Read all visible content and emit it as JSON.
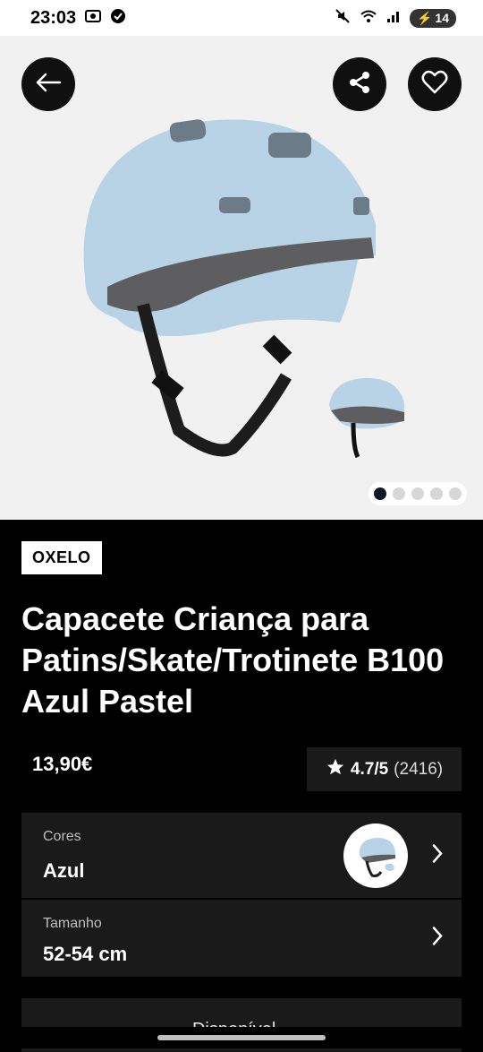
{
  "status_bar": {
    "time": "23:03",
    "battery": "14",
    "icons": [
      "screenshot-icon",
      "check-circle-icon",
      "mute-icon",
      "wifi-icon",
      "signal-icon",
      "battery-icon"
    ]
  },
  "hero": {
    "icons": [
      "back-arrow-icon",
      "share-icon",
      "heart-icon"
    ],
    "image_alt": "helmet",
    "dots_total": 5,
    "active_dot": 1
  },
  "product": {
    "brand": "OXELO",
    "title": "Capacete Criança para Patins/Skate/Trotinete B100 Azul Pastel",
    "price": "13,90€",
    "rating_score": "4.7/5",
    "rating_count": "(2416)"
  },
  "options": {
    "colors_label": "Cores",
    "colors_value": "Azul",
    "size_label": "Tamanho",
    "size_value": "52-54 cm"
  },
  "bottom": {
    "partial_text": "Disponível..."
  },
  "colors": {
    "background": "#000000",
    "hero_bg": "#f1f1f1",
    "card_bg": "#1a1a1a",
    "helmet": "#b9d3e6"
  }
}
